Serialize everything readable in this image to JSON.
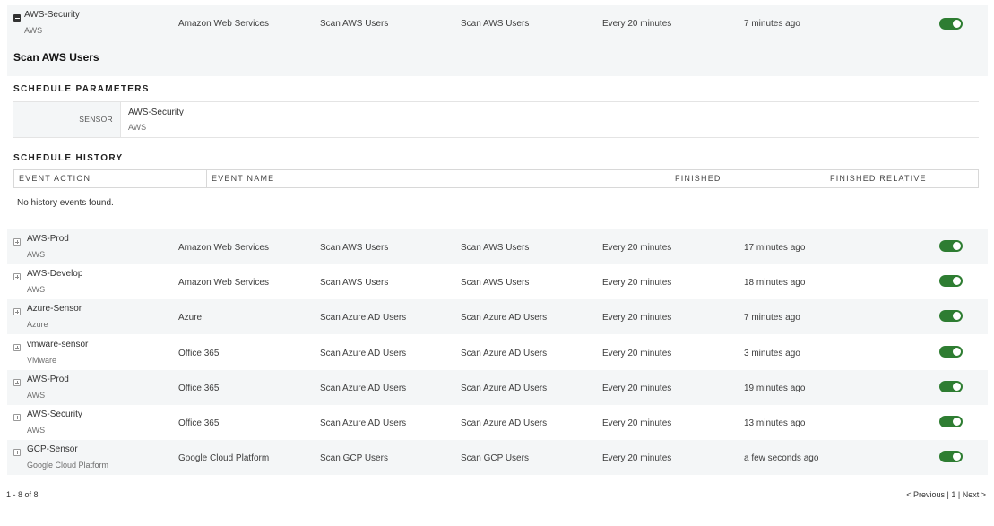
{
  "top_row": {
    "name": "AWS-Security",
    "sub": "AWS",
    "provider": "Amazon Web Services",
    "action": "Scan AWS Users",
    "event": "Scan AWS Users",
    "frequency": "Every 20 minutes",
    "last_run": "7 minutes ago",
    "enabled": true
  },
  "detail": {
    "title": "Scan AWS Users",
    "params_title": "SCHEDULE PARAMETERS",
    "param_label": "SENSOR",
    "param_value": "AWS-Security",
    "param_sub": "AWS",
    "history_title": "SCHEDULE HISTORY",
    "history_columns": [
      "EVENT ACTION",
      "EVENT NAME",
      "FINISHED",
      "FINISHED RELATIVE"
    ],
    "no_events": "No history events found."
  },
  "rows": [
    {
      "name": "AWS-Prod",
      "sub": "AWS",
      "provider": "Amazon Web Services",
      "action": "Scan AWS Users",
      "event": "Scan AWS Users",
      "frequency": "Every 20 minutes",
      "last_run": "17 minutes ago",
      "enabled": true
    },
    {
      "name": "AWS-Develop",
      "sub": "AWS",
      "provider": "Amazon Web Services",
      "action": "Scan AWS Users",
      "event": "Scan AWS Users",
      "frequency": "Every 20 minutes",
      "last_run": "18 minutes ago",
      "enabled": true
    },
    {
      "name": "Azure-Sensor",
      "sub": "Azure",
      "provider": "Azure",
      "action": "Scan Azure AD Users",
      "event": "Scan Azure AD Users",
      "frequency": "Every 20 minutes",
      "last_run": "7 minutes ago",
      "enabled": true
    },
    {
      "name": "vmware-sensor",
      "sub": "VMware",
      "provider": "Office 365",
      "action": "Scan Azure AD Users",
      "event": "Scan Azure AD Users",
      "frequency": "Every 20 minutes",
      "last_run": "3 minutes ago",
      "enabled": true
    },
    {
      "name": "AWS-Prod",
      "sub": "AWS",
      "provider": "Office 365",
      "action": "Scan Azure AD Users",
      "event": "Scan Azure AD Users",
      "frequency": "Every 20 minutes",
      "last_run": "19 minutes ago",
      "enabled": true
    },
    {
      "name": "AWS-Security",
      "sub": "AWS",
      "provider": "Office 365",
      "action": "Scan Azure AD Users",
      "event": "Scan Azure AD Users",
      "frequency": "Every 20 minutes",
      "last_run": "13 minutes ago",
      "enabled": true
    },
    {
      "name": "GCP-Sensor",
      "sub": "Google Cloud Platform",
      "provider": "Google Cloud Platform",
      "action": "Scan GCP Users",
      "event": "Scan GCP Users",
      "frequency": "Every 20 minutes",
      "last_run": "a few seconds ago",
      "enabled": true
    }
  ],
  "footer": {
    "range": "1 - 8 of 8",
    "previous": "< Previous",
    "sep1": "|",
    "page": "1",
    "sep2": "|",
    "next": "Next >"
  },
  "colors": {
    "toggle_on": "#2e7d32",
    "row_alt": "#f4f6f7"
  }
}
